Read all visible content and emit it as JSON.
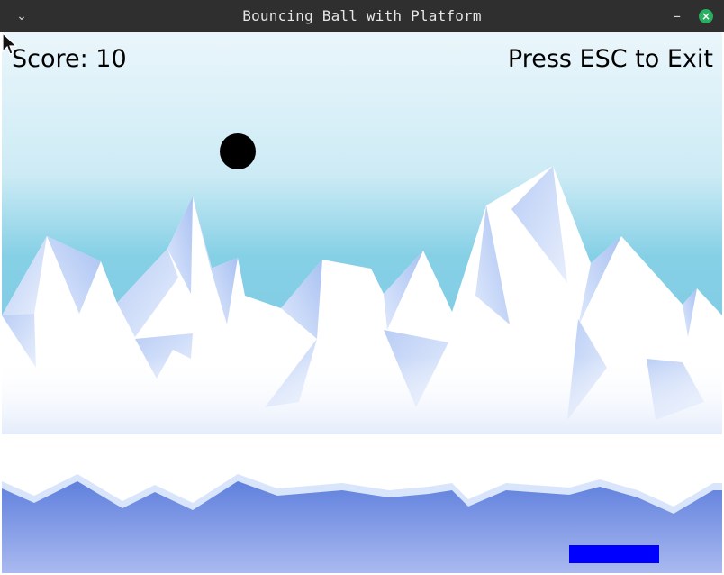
{
  "window": {
    "title": "Bouncing Ball with Platform",
    "menu_icon": "chevron-down-icon",
    "minimize_icon": "minimize-icon",
    "close_icon": "close-icon"
  },
  "hud": {
    "score_text": "Score: 10",
    "exit_hint": "Press ESC to Exit"
  },
  "colors": {
    "ball": "#000000",
    "platform": "#0000ff",
    "sky_top": "#e9f6fb",
    "sky_bottom": "#82cfe6",
    "water": "#6f8fe0"
  }
}
